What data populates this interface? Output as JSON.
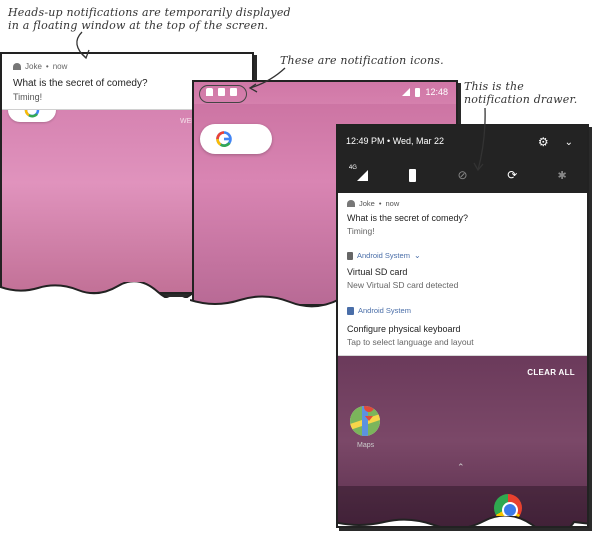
{
  "annotations": {
    "heads_up_line1": "Heads-up notifications are temporarily displayed",
    "heads_up_line2": "in a floating window at the top of the screen.",
    "icons": "These are notification icons.",
    "drawer_line1": "This is the",
    "drawer_line2": "notification drawer."
  },
  "heads_up": {
    "app": "Joke",
    "time": "now",
    "title": "What is the secret of comedy?",
    "text": "Timing!"
  },
  "screen1": {
    "date_fragment": "WED"
  },
  "screen2": {
    "time": "12:48"
  },
  "drawer": {
    "time": "12:49 PM",
    "date": "Wed, Mar 22",
    "network_label": "4G",
    "notifications": [
      {
        "app": "Joke",
        "time": "now",
        "title": "What is the secret of comedy?",
        "text": "Timing!"
      },
      {
        "app": "Android System",
        "title": "Virtual SD card",
        "text": "New Virtual SD card detected"
      },
      {
        "app": "Android System",
        "title": "Configure physical keyboard",
        "text": "Tap to select language and layout"
      }
    ],
    "clear_all": "CLEAR ALL",
    "maps_label": "Maps"
  },
  "colors": {
    "wallpaper": "#d985b3",
    "drawer_header": "#232323",
    "drawer_wallpaper": "#6b3a5b",
    "android_system_accent": "#4a6ea8"
  }
}
